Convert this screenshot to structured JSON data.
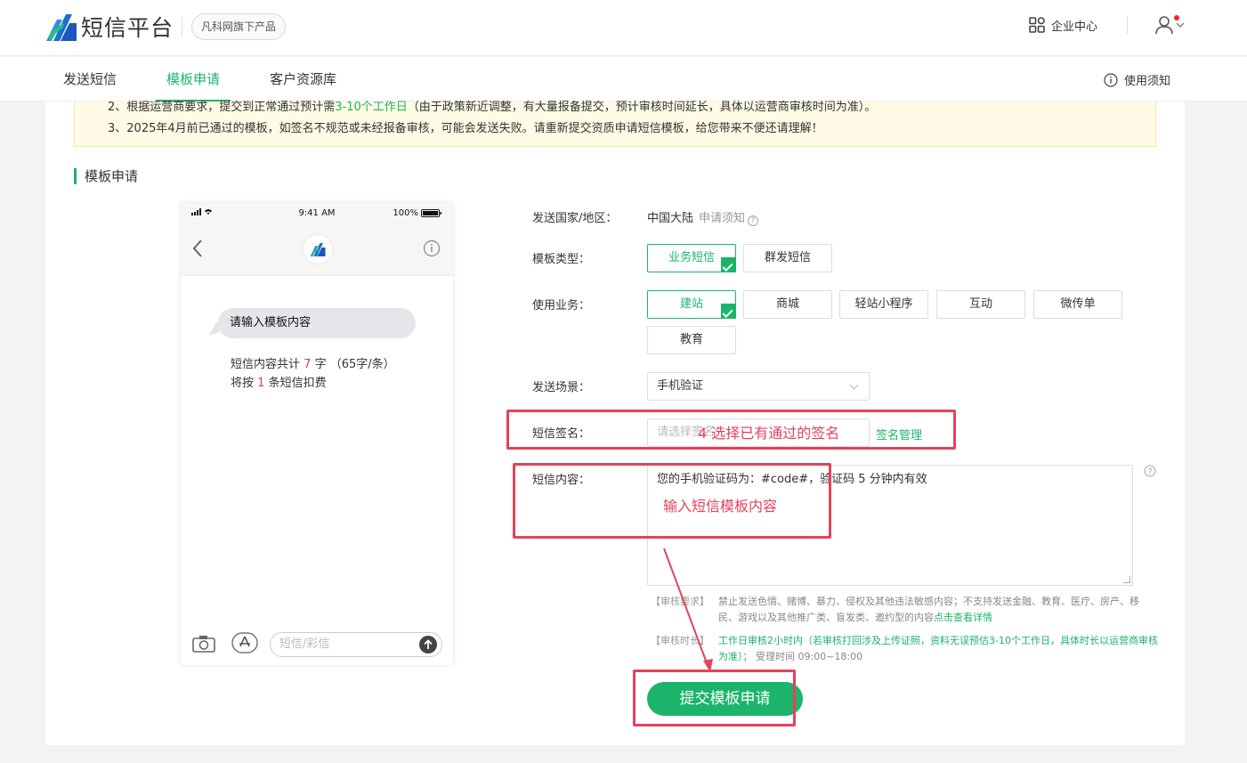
{
  "header": {
    "app_name": "短信平台",
    "badge": "凡科网旗下产品",
    "enterprise_center": "企业中心"
  },
  "nav": {
    "tabs": [
      "发送短信",
      "模板申请",
      "客户资源库"
    ],
    "active_tab": "模板申请",
    "help": "使用须知"
  },
  "notice": {
    "line2_prefix": "2、根据运营商要求，提交到正常通过预计需",
    "line2_highlight": "3-10个工作日",
    "line2_suffix": "（由于政策新近调整，有大量报备提交，预计审核时间延长，具体以运营商审核时间为准）。",
    "line3": "3、2025年4月前已通过的模板，如签名不规范或未经报备审核，可能会发送失败。请重新提交资质申请短信模板，给您带来不便还请理解！"
  },
  "section_title": "模板申请",
  "phone": {
    "time": "9:41 AM",
    "battery": "100%",
    "bubble_text": "请输入模板内容",
    "count_prefix": "短信内容共计",
    "count_chars": "7",
    "count_mid": "字 （65字/条）将按",
    "count_msgs": "1",
    "count_suffix": "条短信扣费",
    "input_placeholder": "短信/彩信"
  },
  "form": {
    "country_label": "发送国家/地区：",
    "country_value": "中国大陆",
    "country_help": "申请须知",
    "type_label": "模板类型：",
    "types": [
      "业务短信",
      "群发短信"
    ],
    "type_selected": "业务短信",
    "business_label": "使用业务：",
    "businesses": [
      "建站",
      "商城",
      "轻站小程序",
      "互动",
      "微传单",
      "教育"
    ],
    "business_selected": "建站",
    "scene_label": "发送场景：",
    "scene_value": "手机验证",
    "sign_label": "短信签名：",
    "sign_placeholder": "请选择签名",
    "sign_manage": "签名管理",
    "content_label": "短信内容：",
    "content_value": "您的手机验证码为：#code#，验证码 5 分钟内有效",
    "review_req_tag": "【审核要求】",
    "review_req_text": "禁止发送色情、赌博、暴力、侵权及其他违法敏感内容；不支持发送金融、教育、医疗、房产、移民、游戏以及其他推广类、盲发类、邀约型的内容",
    "review_req_link": "点击查看详情",
    "review_time_tag": "【审核时长】",
    "review_time_green": "工作日审核2小时内（若审核打回涉及上传证照，资料无误预估3-10个工作日，具体时长以运营商审核为准）；",
    "review_time_gray": "受理时间 09:00~18:00",
    "submit": "提交模板申请"
  },
  "annotations": {
    "sign_note": "4 选择已有通过的签名",
    "content_note": "输入短信模板内容"
  },
  "colors": {
    "brand_green": "#1cb46a",
    "annotation_red": "#e6425b",
    "notice_bg": "#fffbe6"
  }
}
